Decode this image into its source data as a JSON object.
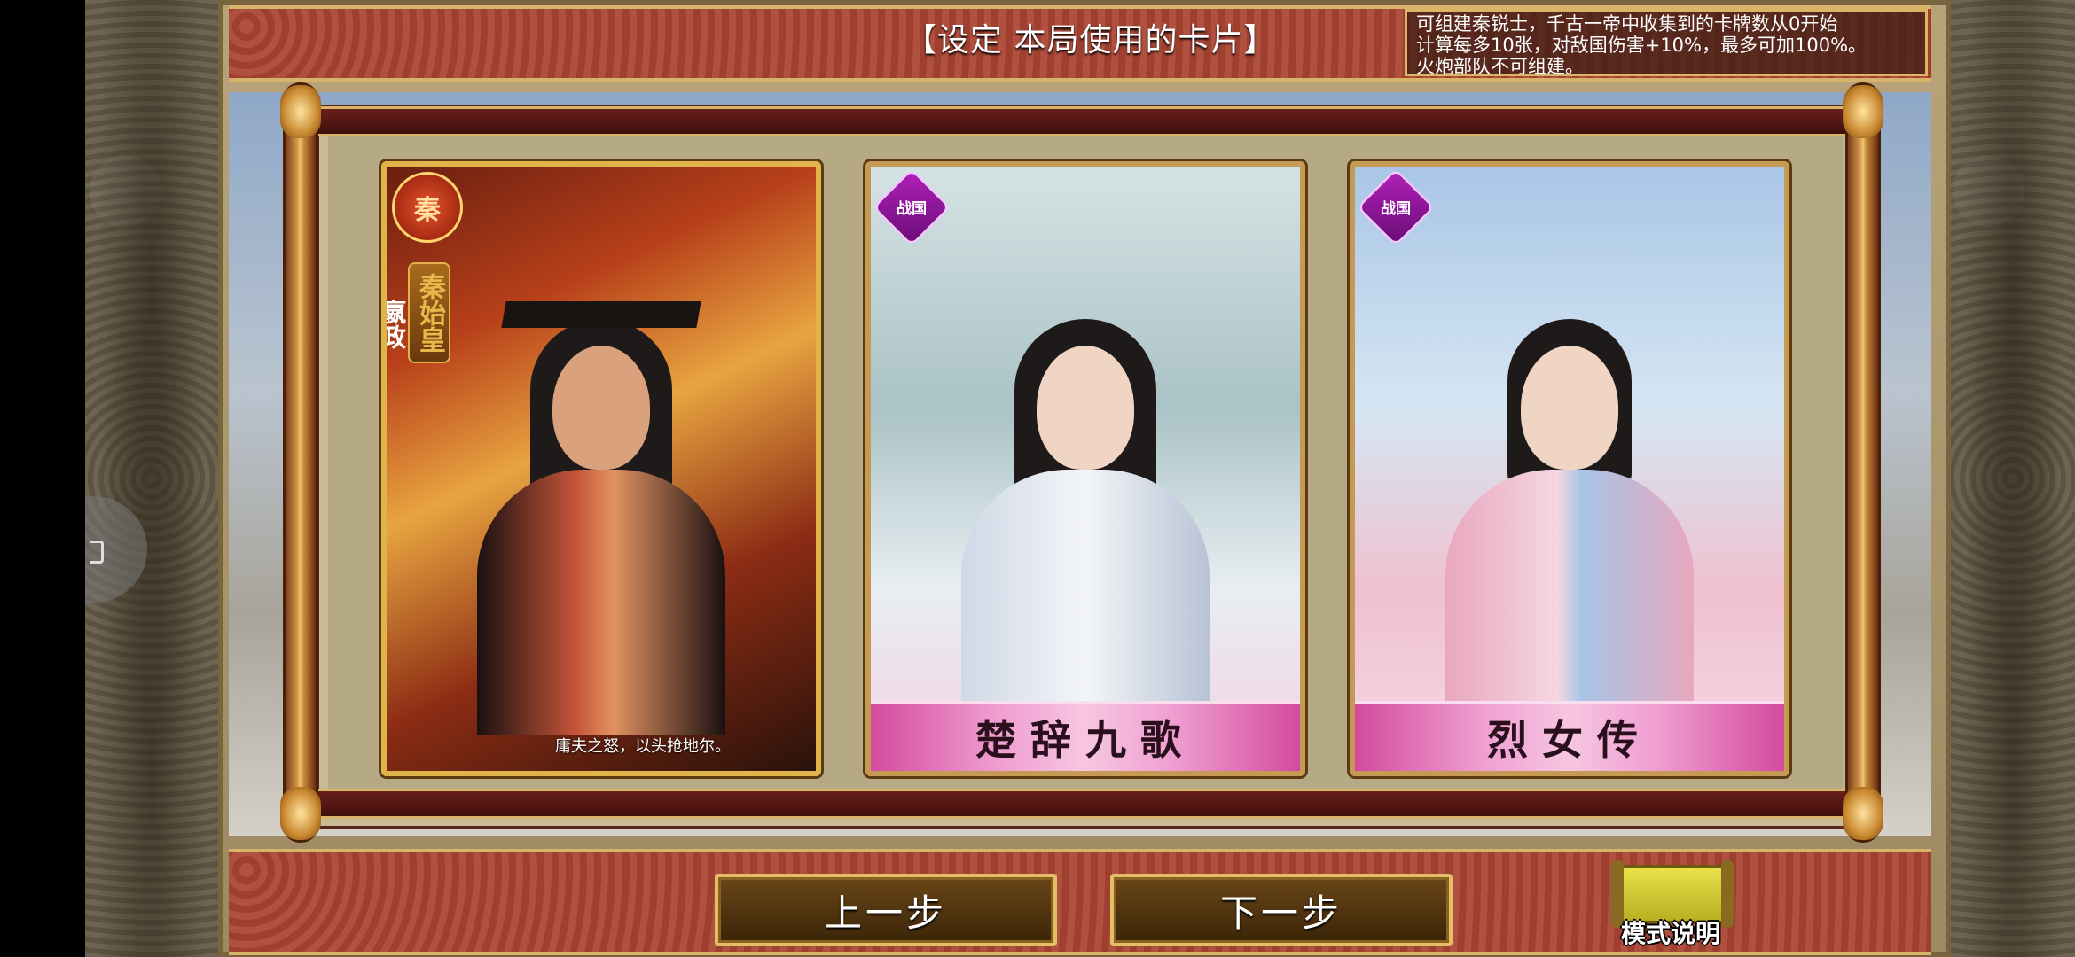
{
  "header": {
    "title": "【设定 本局使用的卡片】",
    "info_lines": [
      "可组建秦锐士，千古一帝中收集到的卡牌数从0开始",
      "计算每多10张，对敌国伤害+10%，最多可加100%。",
      "火炮部队不可组建。"
    ]
  },
  "cards": [
    {
      "badge": "秦",
      "vertical_title": "秦始皇",
      "vertical_subtitle": "嬴政",
      "quote": "庸夫之怒，以头抢地尔。",
      "icon": "qin-badge-icon"
    },
    {
      "badge": "战国",
      "name": "楚辞九歌",
      "icon": "zhanguo-badge-icon"
    },
    {
      "badge": "战国",
      "name": "烈女传",
      "icon": "zhanguo-badge-icon"
    }
  ],
  "buttons": {
    "prev": "上一步",
    "next": "下一步",
    "mode_help": "模式说明"
  },
  "colors": {
    "banner_red": "#9e3f30",
    "gold_border": "#d7b46a",
    "zhanguo_purple": "#b021b8",
    "name_bar_pink": "#ef9fd1"
  }
}
